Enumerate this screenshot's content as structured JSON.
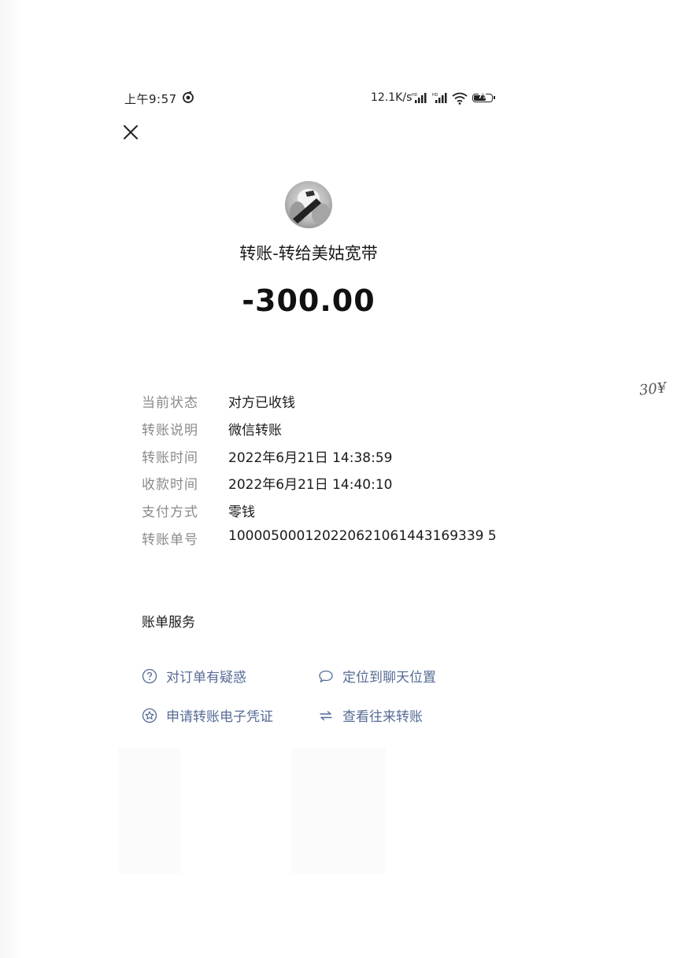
{
  "status_bar": {
    "time": "上午9:57",
    "net_speed": "12.1K/s",
    "battery_level": "73",
    "battery_fraction": 0.73
  },
  "icons": {
    "close": "close-icon",
    "app_status": "circular-app-icon",
    "signal": "signal-hd-icon",
    "wifi": "wifi-icon",
    "battery": "battery-icon",
    "dispute": "question-circle-icon",
    "locate": "chat-bubble-icon",
    "voucher": "star-circle-icon",
    "history": "swap-arrows-icon"
  },
  "transaction": {
    "title": "转账-转给美姑宽带",
    "amount": "-300.00"
  },
  "details": [
    {
      "label": "当前状态",
      "value": "对方已收钱"
    },
    {
      "label": "转账说明",
      "value": "微信转账"
    },
    {
      "label": "转账时间",
      "value": "2022年6月21日 14:38:59"
    },
    {
      "label": "收款时间",
      "value": "2022年6月21日 14:40:10"
    },
    {
      "label": "支付方式",
      "value": "零钱"
    },
    {
      "label": "转账单号",
      "value": "100005000120220621061443169339 5"
    }
  ],
  "services": {
    "title": "账单服务",
    "dispute_label": "对订单有疑惑",
    "locate_label": "定位到聊天位置",
    "voucher_label": "申请转账电子凭证",
    "history_label": "查看往来转账"
  },
  "annotation": {
    "handwritten": "30¥"
  },
  "colors": {
    "link": "#576b95",
    "label": "#8a8a8a",
    "text": "#1a1a1a"
  }
}
